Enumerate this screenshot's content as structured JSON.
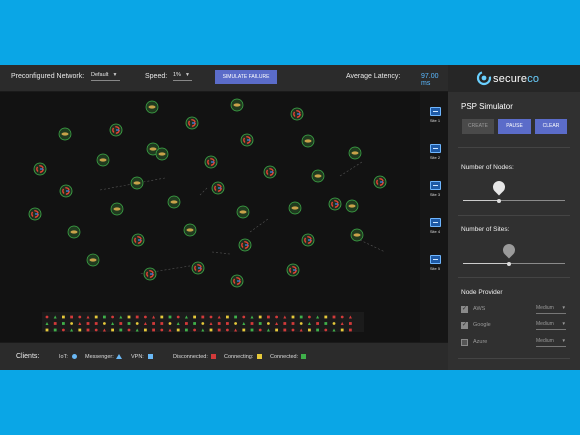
{
  "topbar": {
    "network_label": "Preconfigured Network:",
    "network_value": "Default",
    "speed_label": "Speed:",
    "speed_value": "1%",
    "simulate_failure_label": "SIMULATE FAILURE",
    "latency_label": "Average Latency:",
    "latency_value": "97.00 ms"
  },
  "sites": [
    {
      "label": "Site 1"
    },
    {
      "label": "Site 2"
    },
    {
      "label": "Site 3"
    },
    {
      "label": "Site 4"
    },
    {
      "label": "Site 5"
    }
  ],
  "clientbar": {
    "title": "Clients:",
    "iot_label": "IoT:",
    "messenger_label": "Messenger:",
    "vpn_label": "VPN:",
    "disconnected_label": "Disconnected:",
    "connecting_label": "Connecting:",
    "connected_label": "Connected:"
  },
  "panel": {
    "logo_main": "secure",
    "logo_accent": "co",
    "title": "PSP Simulator",
    "create_label": "CREATE",
    "pause_label": "PAUSE",
    "clear_label": "CLEAR",
    "nodes_label": "Number of Nodes:",
    "nodes_fraction": 0.35,
    "sites_label": "Number of Sites:",
    "sites_fraction": 0.45,
    "provider_label": "Node Provider",
    "providers": [
      {
        "name": "AWS",
        "checked": true,
        "tier": "Medium"
      },
      {
        "name": "Google",
        "checked": true,
        "tier": "Medium"
      },
      {
        "name": "Azure",
        "checked": false,
        "tier": "Medium"
      }
    ]
  },
  "colors": {
    "accent": "#5b6cc9",
    "latency": "#5ab8ff",
    "iot": "#6ab8f5",
    "messenger": "#6ab8f5",
    "vpn": "#6ab8f5",
    "disconnected": "#d23a3a",
    "connecting": "#e6c93a",
    "connected": "#3fb04a",
    "background": "#0aa6e6"
  },
  "icons": {
    "google_node": "google-g-icon",
    "generic_node": "cloud-node-icon",
    "site": "server-icon",
    "logo": "secureco-logo-icon"
  }
}
